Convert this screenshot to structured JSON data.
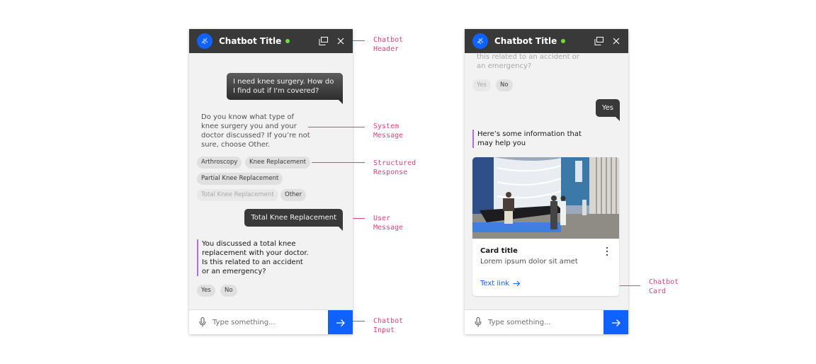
{
  "left_chatbot": {
    "header": {
      "title": "Chatbot Title",
      "status": "online"
    },
    "messages": {
      "user_1": "I need knee surgery. How do I find out if I'm covered?",
      "system_1": "Do you know what type of knee surgery you and your doctor discussed? If you’re not sure, choose Other.",
      "chips_1": [
        "Arthroscopy",
        "Knee Replacement",
        "Partial Knee Replacement",
        "Total Knee Replacement",
        "Other"
      ],
      "user_2": "Total Knee Replacement",
      "system_2": "You discussed a total knee replacement with your doctor. Is this related to an accident or an emergency?",
      "chips_2": [
        "Yes",
        "No"
      ]
    },
    "input": {
      "placeholder": "Type something..."
    }
  },
  "right_chatbot": {
    "header": {
      "title": "Chatbot Title",
      "status": "online"
    },
    "messages": {
      "system_prev_tail": "this related to an accident or an emergency?",
      "chips_prev": [
        "Yes",
        "No"
      ],
      "user_1": "Yes",
      "system_1": "Here’s some information that may help you"
    },
    "card": {
      "title": "Card title",
      "description": "Lorem ipsum dolor sit amet",
      "link": "Text link"
    },
    "input": {
      "placeholder": "Type something..."
    }
  },
  "annotations": {
    "chatbot_header": "Chatbot\nHeader",
    "system_message": "System\nMessage",
    "structured_response": "Structured\nResponse",
    "user_message": "User\nMessage",
    "chatbot_input": "Chatbot\nInput",
    "chatbot_card": "Chatbot\nCard"
  },
  "colors": {
    "header_bg": "#393939",
    "accent_blue": "#0f62fe",
    "status_green": "#6fdc3c",
    "annotation_pink": "#e0447a",
    "message_accent_purple": "#a56eff"
  }
}
